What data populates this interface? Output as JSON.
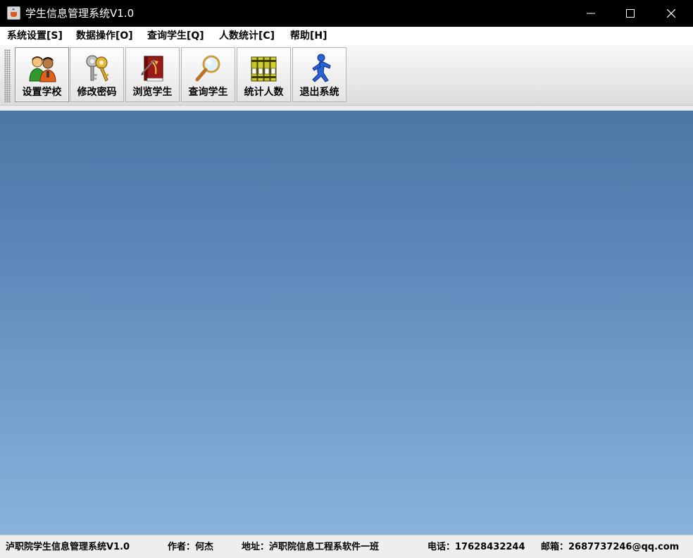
{
  "window": {
    "title": "学生信息管理系统V1.0",
    "controls": {
      "minimize": "minimize",
      "maximize": "maximize",
      "close": "close"
    }
  },
  "menu": {
    "items": [
      {
        "label": "系统设置[S]"
      },
      {
        "label": "数据操作[O]"
      },
      {
        "label": "查询学生[Q]"
      },
      {
        "label": "人数统计[C]"
      },
      {
        "label": "帮助[H]"
      }
    ]
  },
  "toolbar": {
    "buttons": [
      {
        "label": "设置学校",
        "icon": "users-icon"
      },
      {
        "label": "修改密码",
        "icon": "keys-icon"
      },
      {
        "label": "浏览学生",
        "icon": "book-icon"
      },
      {
        "label": "查询学生",
        "icon": "magnifier-icon"
      },
      {
        "label": "统计人数",
        "icon": "binders-icon"
      },
      {
        "label": "退出系统",
        "icon": "running-man-icon"
      }
    ]
  },
  "status": {
    "system": "泸职院学生信息管理系统V1.0",
    "author": "作者：何杰",
    "address": "地址：泸职院信息工程系软件一班",
    "phone": "电话：17628432244",
    "email": "邮箱：2687737246@qq.com"
  },
  "colors": {
    "titlebar": "#000000",
    "desktop_top": "#4b76a6",
    "desktop_bottom": "#8ab3db"
  }
}
